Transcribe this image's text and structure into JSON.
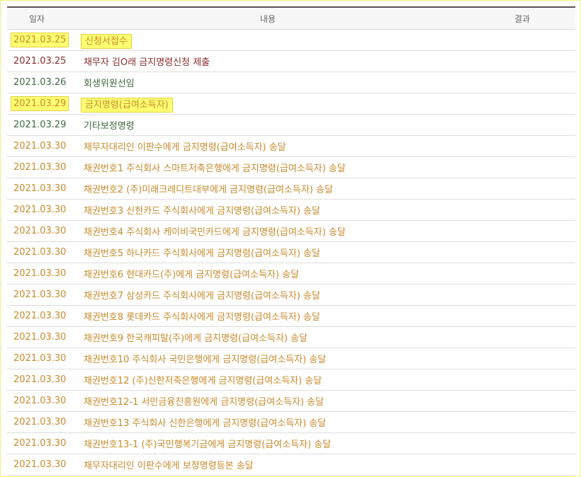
{
  "header": {
    "date": "일자",
    "content": "내용",
    "result": "결과"
  },
  "colors": {
    "brown": "#8a2c2c",
    "green": "#3d6b3d",
    "orange": "#c98a2b",
    "highlight": "#ffff72"
  },
  "rows": [
    {
      "date": "2021.03.25",
      "content": "신청서접수",
      "result": ""
    },
    {
      "date": "2021.03.25",
      "content": "채무자 김O래 금지명령신청 제출",
      "result": ""
    },
    {
      "date": "2021.03.26",
      "content": "회생위원선임",
      "result": ""
    },
    {
      "date": "2021.03.29",
      "content": "금지명령(급여소득자)",
      "result": ""
    },
    {
      "date": "2021.03.29",
      "content": "기타보정명령",
      "result": ""
    },
    {
      "date": "2021.03.30",
      "content": "채무자대리인 이판수에게 금지명령(급여소득자) 송달",
      "result": ""
    },
    {
      "date": "2021.03.30",
      "content": "채권번호1 주식회사 스마트저축은행에게 금지명령(급여소득자) 송달",
      "result": ""
    },
    {
      "date": "2021.03.30",
      "content": "채권번호2 (주)미래크레디트대부에게 금지명령(급여소득자) 송달",
      "result": ""
    },
    {
      "date": "2021.03.30",
      "content": "채권번호3 신한카드 주식회사에게 금지명령(급여소득자) 송달",
      "result": ""
    },
    {
      "date": "2021.03.30",
      "content": "채권번호4 주식회사 케이비국민카드에게 금지명령(급여소득자) 송달",
      "result": ""
    },
    {
      "date": "2021.03.30",
      "content": "채권번호5 하나카드 주식회사에게 금지명령(급여소득자) 송달",
      "result": ""
    },
    {
      "date": "2021.03.30",
      "content": "채권번호6 현대카드(주)에게 금지명령(급여소득자) 송달",
      "result": ""
    },
    {
      "date": "2021.03.30",
      "content": "채권번호7 삼성카드 주식회사에게 금지명령(급여소득자) 송달",
      "result": ""
    },
    {
      "date": "2021.03.30",
      "content": "채권번호8 롯데카드 주식회사에게 금지명령(급여소득자) 송달",
      "result": ""
    },
    {
      "date": "2021.03.30",
      "content": "채권번호9 한국캐피탈(주)에게 금지명령(급여소득자) 송달",
      "result": ""
    },
    {
      "date": "2021.03.30",
      "content": "채권번호10 주식회사 국민은행에게 금지명령(급여소득자) 송달",
      "result": ""
    },
    {
      "date": "2021.03.30",
      "content": "채권번호12 (주)신한저축은행에게 금지명령(급여소득자) 송달",
      "result": ""
    },
    {
      "date": "2021.03.30",
      "content": "채권번호12-1 서민금융진흥원에게 금지명령(급여소득자) 송달",
      "result": ""
    },
    {
      "date": "2021.03.30",
      "content": "채권번호13 주식회사 신한은행에게 금지명령(급여소득자) 송달",
      "result": ""
    },
    {
      "date": "2021.03.30",
      "content": "채권번호13-1 (주)국민행복기금에게 금지명령(급여소득자) 송달",
      "result": ""
    },
    {
      "date": "2021.03.30",
      "content": "채무자대리인 이판수에게 보정명령등본 송달",
      "result": ""
    }
  ]
}
